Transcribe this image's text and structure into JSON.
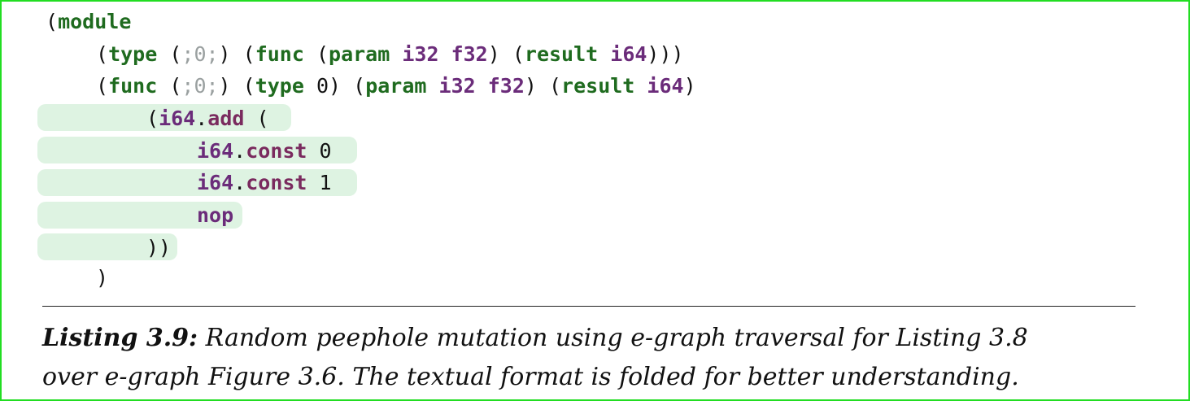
{
  "listing": {
    "lines": [
      [
        "(",
        "module"
      ],
      [
        "(",
        "type",
        " (",
        ";0;",
        ") (",
        "func",
        " (",
        "param",
        " ",
        "i32",
        " ",
        "f32",
        ") (",
        "result",
        " ",
        "i64",
        ")))"
      ],
      [
        "(",
        "func",
        " (",
        ";0;",
        ") (",
        "type",
        " 0) (",
        "param",
        " ",
        "i32",
        " ",
        "f32",
        ") (",
        "result",
        " ",
        "i64",
        ")"
      ],
      [
        "(",
        "i64",
        ".",
        "add",
        " ("
      ],
      [
        "i64",
        ".",
        "const",
        " 0"
      ],
      [
        "i64",
        ".",
        "const",
        " 1"
      ],
      [
        "nop"
      ],
      [
        "))"
      ],
      [
        ")"
      ]
    ]
  },
  "colors": {
    "frame_border": "#22dd22",
    "highlight": "#def3e2",
    "keyword": "#1f6b1f",
    "type": "#6b2c7a",
    "comment": "#9aa0a0"
  },
  "caption": {
    "label": "Listing 3.9:",
    "text_line1": " Random peephole mutation using e-graph traversal for Listing 3.8",
    "text_line2": "over e-graph Figure 3.6. The textual format is folded for better understanding."
  }
}
